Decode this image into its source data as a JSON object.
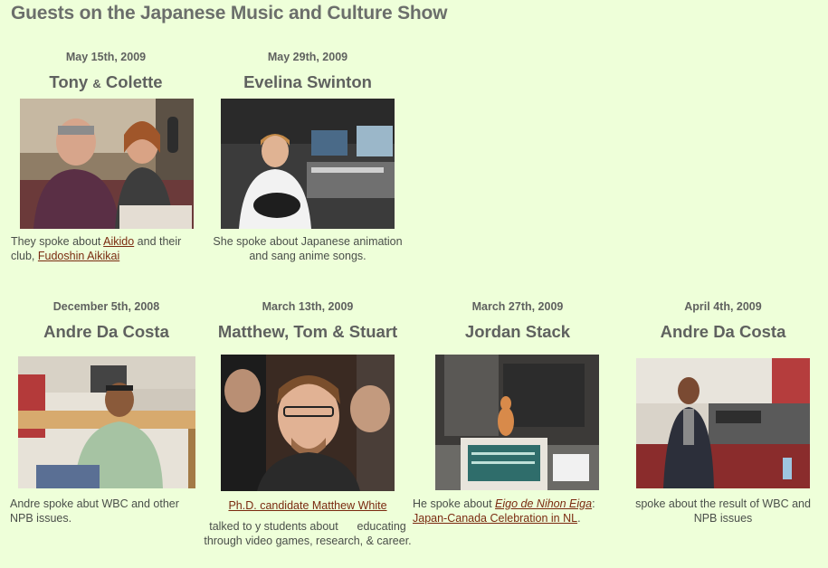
{
  "page_title": "Guests on the Japanese Music and Culture Show",
  "row1": [
    {
      "date": "May 15th, 2009",
      "name_a": "Tony",
      "amp": "&",
      "name_b": "Colette",
      "desc_pre": "They spoke about ",
      "link1": "Aikido",
      "desc_mid": " and their club, ",
      "link2": "Fudoshin Aikikai"
    },
    {
      "date": "May 29th, 2009",
      "name": "Evelina Swinton",
      "desc": "She spoke about Japanese animation and sang anime songs."
    }
  ],
  "row2": [
    {
      "date": "December 5th, 2008",
      "name": "Andre Da Costa",
      "desc": "Andre spoke abut WBC and other NPB issues."
    },
    {
      "date": "March 13th, 2009",
      "name": "Matthew, Tom & Stuart",
      "link": "Ph.D. candidate Matthew White",
      "desc": "talked to y students about      educating through video games, research, & career."
    },
    {
      "date": "March 27th, 2009",
      "name": "Jordan Stack",
      "desc_pre": "He spoke about ",
      "link": "Eigo de Nihon Eiga",
      "desc_mid": ": ",
      "link2": "Japan-Canada Celebration in NL",
      "desc_post": "."
    },
    {
      "date": "April 4th, 2009",
      "name": "Andre Da Costa",
      "desc": "spoke about the result of WBC and NPB issues"
    }
  ]
}
